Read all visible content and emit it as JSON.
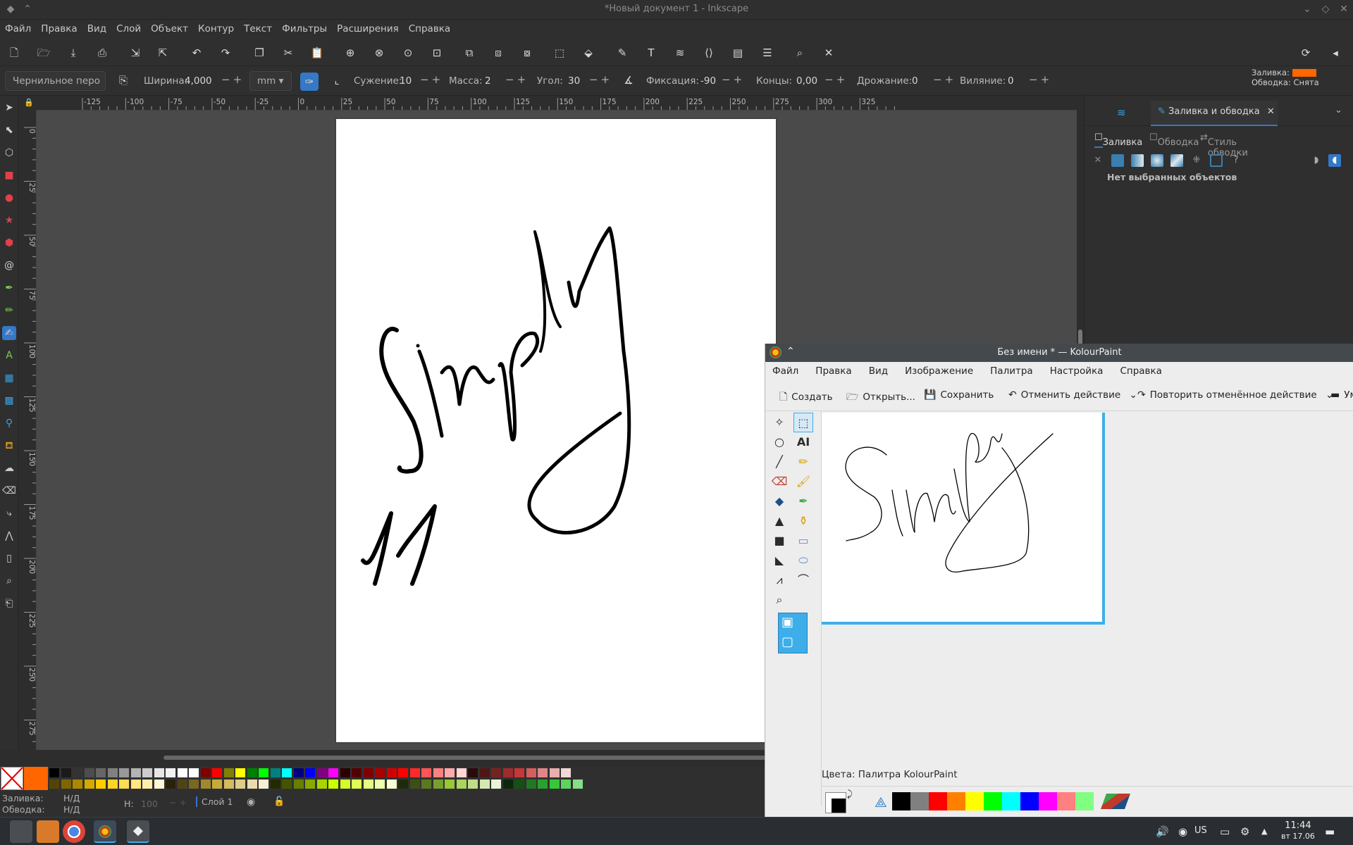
{
  "inkscape": {
    "title": "*Новый документ 1 - Inkscape",
    "menu": [
      "Файл",
      "Правка",
      "Вид",
      "Слой",
      "Объект",
      "Контур",
      "Текст",
      "Фильтры",
      "Расширения",
      "Справка"
    ],
    "tool_controls": {
      "tool_preset": "Чернильное перо",
      "width_label": "Ширина:",
      "width_value": "4,000",
      "unit": "mm",
      "thinning_label": "Сужение:",
      "thinning_value": "10",
      "mass_label": "Масса:",
      "mass_value": "2",
      "angle_label": "Угол:",
      "angle_value": "30",
      "fixation_label": "Фиксация:",
      "fixation_value": "-90",
      "caps_label": "Концы:",
      "caps_value": "0,00",
      "tremor_label": "Дрожание:",
      "tremor_value": "0",
      "wiggle_label": "Виляние:",
      "wiggle_value": "0"
    },
    "style_indicator": {
      "fill_label": "Заливка:",
      "stroke_label": "Обводка:",
      "stroke_value": "Снята",
      "fill_color": "#ff6600"
    },
    "ruler_top": [
      "-125",
      "-100",
      "-75",
      "-50",
      "-25",
      "0",
      "25",
      "50",
      "75",
      "100",
      "125",
      "150",
      "175",
      "200",
      "225",
      "250",
      "275",
      "300",
      "325"
    ],
    "ruler_left": [
      "0",
      "25",
      "50",
      "75",
      "100",
      "125",
      "150",
      "175",
      "200",
      "225",
      "250",
      "275"
    ],
    "dock": {
      "tab_title": "Заливка и обводка",
      "sub_tabs": [
        "Заливка",
        "Обводка",
        "Стиль обводки"
      ],
      "no_selection": "Нет выбранных объектов"
    },
    "status": {
      "fill_label": "Заливка:",
      "fill_value": "Н/Д",
      "stroke_label": "Обводка:",
      "stroke_value": "Н/Д",
      "h_label": "Н:",
      "h_value": "100",
      "layer": "Слой 1"
    }
  },
  "kolourpaint": {
    "title": "Без имени * — KolourPaint",
    "menu": [
      "Файл",
      "Правка",
      "Вид",
      "Изображение",
      "Палитра",
      "Настройка",
      "Справка"
    ],
    "toolbar": {
      "create": "Создать",
      "open": "Открыть...",
      "save": "Сохранить",
      "undo": "Отменить действие",
      "redo": "Повторить отменённое действие",
      "more": "Ум"
    },
    "status": "Цвета: Палитра KolourPaint",
    "palette": [
      "#000000",
      "#808080",
      "#ff0000",
      "#ff8000",
      "#ffff00",
      "#00ff00",
      "#00ffff",
      "#0000ff",
      "#ff00ff",
      "#ff8080",
      "#80ff80"
    ]
  },
  "taskbar": {
    "lang": "US",
    "time": "11:44",
    "date": "вт 17.06"
  },
  "icons": [
    "inkscape-logo-icon",
    "new-doc-icon",
    "open-icon",
    "save-icon",
    "print-icon",
    "undo-icon",
    "redo-icon",
    "zoom-icon",
    "text-tool-icon",
    "calligraphy-tool-icon"
  ]
}
